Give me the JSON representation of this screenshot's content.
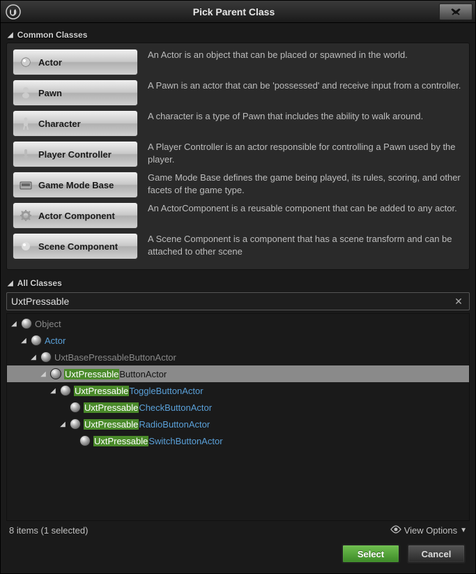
{
  "title": "Pick Parent Class",
  "sections": {
    "common": "Common Classes",
    "all": "All Classes"
  },
  "common_classes": [
    {
      "name": "Actor",
      "desc": "An Actor is an object that can be placed or spawned in the world."
    },
    {
      "name": "Pawn",
      "desc": "A Pawn is an actor that can be 'possessed' and receive input from a controller."
    },
    {
      "name": "Character",
      "desc": "A character is a type of Pawn that includes the ability to walk around."
    },
    {
      "name": "Player Controller",
      "desc": "A Player Controller is an actor responsible for controlling a Pawn used by the player."
    },
    {
      "name": "Game Mode Base",
      "desc": "Game Mode Base defines the game being played, its rules, scoring, and other facets of the game type."
    },
    {
      "name": "Actor Component",
      "desc": "An ActorComponent is a reusable component that can be added to any actor."
    },
    {
      "name": "Scene Component",
      "desc": "A Scene Component is a component that has a scene transform and can be attached to other scene"
    }
  ],
  "search": {
    "value": "UxtPressable"
  },
  "highlight": "UxtPressable",
  "tree": [
    {
      "indent": 0,
      "expanded": true,
      "label": "Object",
      "style": "dim"
    },
    {
      "indent": 1,
      "expanded": true,
      "label": "Actor",
      "style": "link"
    },
    {
      "indent": 2,
      "expanded": true,
      "label": "UxtBasePressableButtonActor",
      "style": "dim"
    },
    {
      "indent": 3,
      "expanded": true,
      "label": "UxtPressableButtonActor",
      "style": "selected",
      "selected": true
    },
    {
      "indent": 4,
      "expanded": true,
      "label": "UxtPressableToggleButtonActor",
      "style": "link"
    },
    {
      "indent": 5,
      "expanded": false,
      "label": "UxtPressableCheckButtonActor",
      "style": "link",
      "leaf": true
    },
    {
      "indent": 5,
      "expanded": true,
      "label": "UxtPressableRadioButtonActor",
      "style": "link"
    },
    {
      "indent": 6,
      "expanded": false,
      "label": "UxtPressableSwitchButtonActor",
      "style": "link",
      "leaf": true
    }
  ],
  "footer": {
    "count": "8 items (1 selected)",
    "view_options": "View Options"
  },
  "buttons": {
    "select": "Select",
    "cancel": "Cancel"
  }
}
